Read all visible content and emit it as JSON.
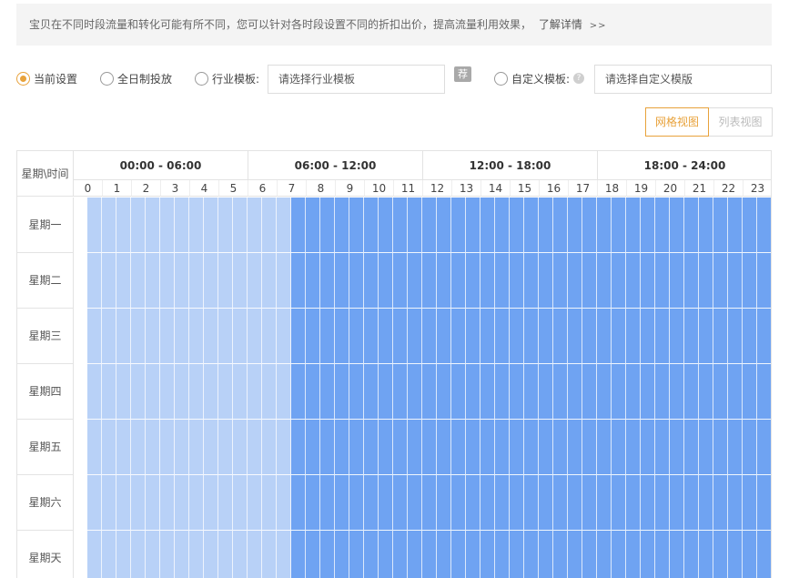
{
  "notice": {
    "text": "宝贝在不同时段流量和转化可能有所不同，您可以针对各时段设置不同的折扣出价，提高流量利用效果，",
    "link": "了解详情",
    "more": ">>"
  },
  "options": {
    "current": "当前设置",
    "full_day": "全日制投放",
    "industry_label": "行业模板:",
    "industry_placeholder": "请选择行业模板",
    "tag_icon_text": "荐",
    "custom_label": "自定义模板:",
    "custom_placeholder": "请选择自定义模版",
    "selected": "current"
  },
  "views": {
    "grid": "网格视图",
    "list": "列表视图",
    "active": "grid"
  },
  "grid": {
    "corner": "星期\\时间",
    "periods": [
      "00:00 - 06:00",
      "06:00 - 12:00",
      "12:00 - 18:00",
      "18:00 - 24:00"
    ],
    "hours": [
      "0",
      "1",
      "2",
      "3",
      "4",
      "5",
      "6",
      "7",
      "8",
      "9",
      "10",
      "11",
      "12",
      "13",
      "14",
      "15",
      "16",
      "17",
      "18",
      "19",
      "20",
      "21",
      "22",
      "23"
    ],
    "days": [
      "星期一",
      "星期二",
      "星期三",
      "星期四",
      "星期五",
      "星期六",
      "星期天"
    ],
    "levels_per_day": [
      "low",
      "low",
      "low",
      "low",
      "low",
      "low",
      "low",
      "high",
      "high",
      "high",
      "high",
      "high",
      "high",
      "high",
      "high",
      "high",
      "high",
      "high",
      "high",
      "high",
      "high",
      "high",
      "high",
      "high"
    ],
    "colors": {
      "low": "#b8d1f7",
      "high": "#6fa3f2",
      "accent": "#e8a23b"
    }
  }
}
